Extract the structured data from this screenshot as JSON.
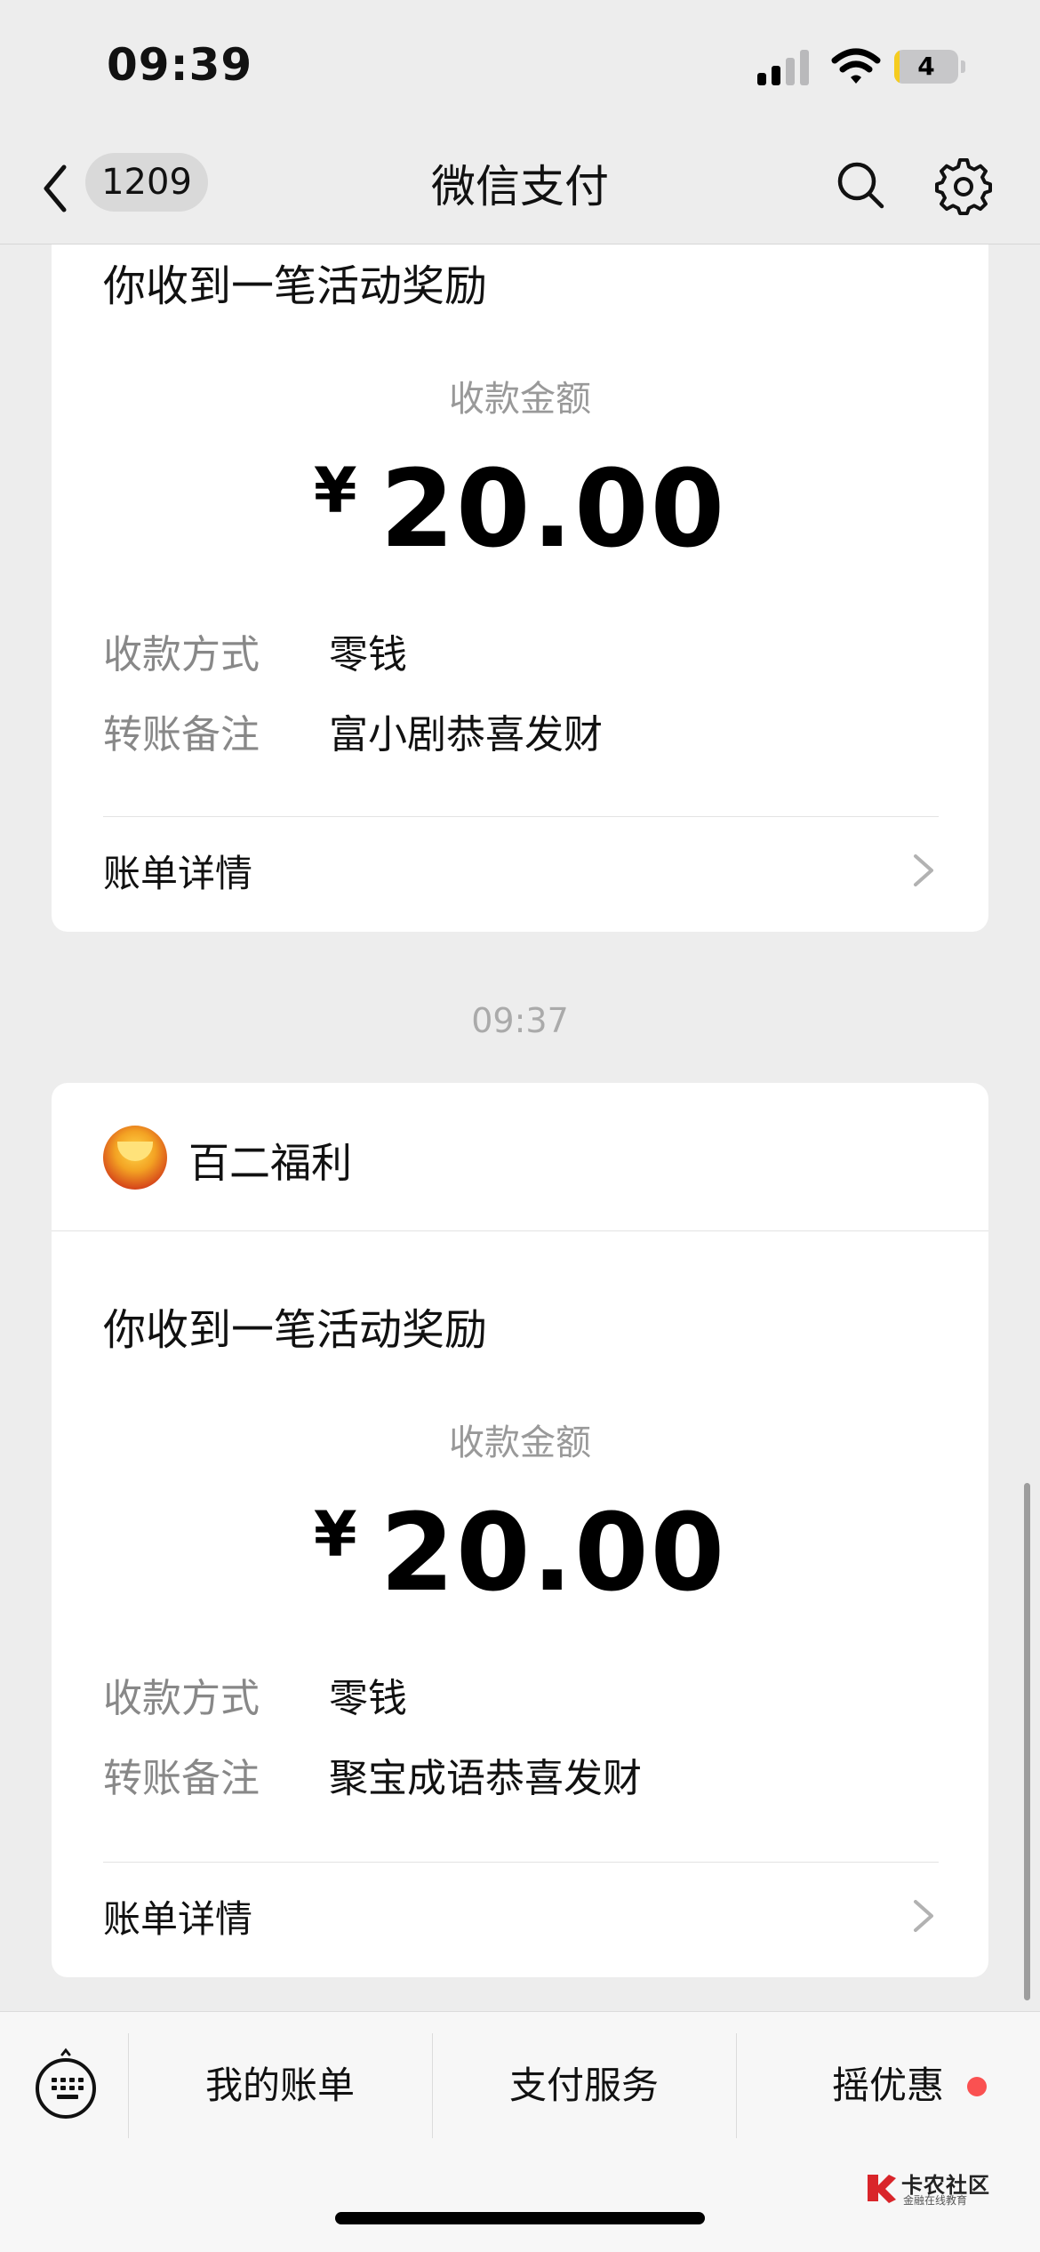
{
  "status_bar": {
    "time": "09:39",
    "battery_level": "4",
    "battery_percent": 4
  },
  "nav": {
    "unread_count": "1209",
    "title": "微信支付"
  },
  "messages": [
    {
      "title": "你收到一笔活动奖励",
      "amount_caption": "收款金额",
      "currency": "¥",
      "amount": "20.00",
      "rows": [
        {
          "label": "收款方式",
          "value": "零钱"
        },
        {
          "label": "转账备注",
          "value": "富小剧恭喜发财"
        }
      ],
      "detail_label": "账单详情"
    },
    {
      "timestamp": "09:37",
      "merchant": "百二福利",
      "title": "你收到一笔活动奖励",
      "amount_caption": "收款金额",
      "currency": "¥",
      "amount": "20.00",
      "rows": [
        {
          "label": "收款方式",
          "value": "零钱"
        },
        {
          "label": "转账备注",
          "value": "聚宝成语恭喜发财"
        }
      ],
      "detail_label": "账单详情"
    }
  ],
  "bottom_menu": {
    "items": [
      "我的账单",
      "支付服务",
      "摇优惠"
    ]
  },
  "watermark": {
    "title": "卡农社区",
    "subtitle": "金融在线教育"
  },
  "colors": {
    "background": "#ededed",
    "card": "#ffffff",
    "notify_dot": "#fa5151",
    "battery": "#f5cc1f"
  }
}
